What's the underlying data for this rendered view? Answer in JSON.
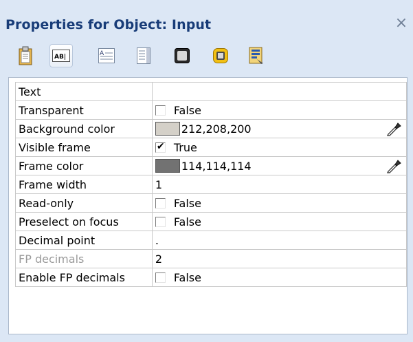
{
  "window": {
    "title": "Properties for Object: Input",
    "close_glyph": "×"
  },
  "toolbar": {
    "tabs": [
      {
        "icon": "clipboard-icon",
        "active": false
      },
      {
        "icon": "text-field-icon",
        "active": true
      },
      {
        "icon": "text-area-icon",
        "active": false
      },
      {
        "icon": "scroll-list-icon",
        "active": false
      },
      {
        "icon": "dark-frame-icon",
        "active": false
      },
      {
        "icon": "yellow-frame-icon",
        "active": false
      },
      {
        "icon": "properties-document-icon",
        "active": false
      }
    ]
  },
  "properties": [
    {
      "name": "Text",
      "value": "",
      "type": "text"
    },
    {
      "name": "Transparent",
      "value": "False",
      "type": "checkbox",
      "checked": false
    },
    {
      "name": "Background color",
      "value": "212,208,200",
      "type": "color",
      "color": "#d4d0c8"
    },
    {
      "name": "Visible frame",
      "value": "True",
      "type": "checkbox",
      "checked": true
    },
    {
      "name": "Frame color",
      "value": "114,114,114",
      "type": "color",
      "color": "#727272"
    },
    {
      "name": "Frame width",
      "value": "1",
      "type": "text"
    },
    {
      "name": "Read-only",
      "value": "False",
      "type": "checkbox",
      "checked": false
    },
    {
      "name": "Preselect on focus",
      "value": "False",
      "type": "checkbox",
      "checked": false
    },
    {
      "name": "Decimal point",
      "value": ".",
      "type": "text"
    },
    {
      "name": "FP decimals",
      "value": "2",
      "type": "text",
      "disabled": true
    },
    {
      "name": "Enable FP decimals",
      "value": "False",
      "type": "checkbox",
      "checked": false
    }
  ],
  "colors": {
    "title_text": "#183c78",
    "panel_bg": "#dce7f5",
    "disabled_text": "#9a9a9a"
  }
}
